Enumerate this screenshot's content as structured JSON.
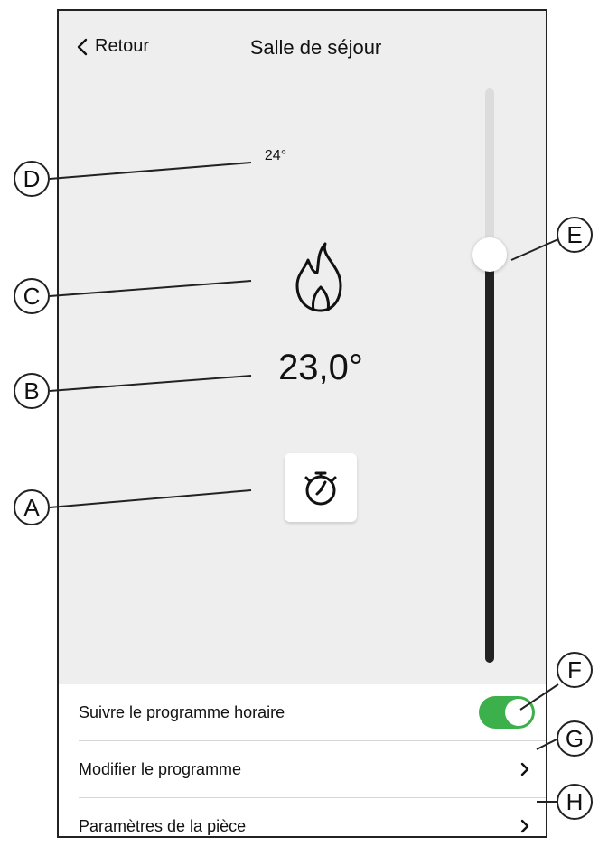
{
  "header": {
    "back_label": "Retour",
    "title": "Salle de séjour"
  },
  "main": {
    "setpoint": "24°",
    "current_temp": "23,0°",
    "slider_level_percent": 71
  },
  "settings": {
    "items": [
      {
        "label": "Suivre le programme horaire",
        "toggle_on": true
      },
      {
        "label": "Modifier le programme"
      },
      {
        "label": "Paramètres de la pièce"
      }
    ]
  },
  "callouts": [
    "A",
    "B",
    "C",
    "D",
    "E",
    "F",
    "G",
    "H"
  ],
  "colors": {
    "toggle_on": "#3cb04a",
    "background": "#eeeeee",
    "slider_fill": "#222222",
    "slider_track": "#dcdcdc"
  },
  "icons": [
    "chevron-left-icon",
    "flame-icon",
    "timer-icon",
    "chevron-right-icon"
  ]
}
